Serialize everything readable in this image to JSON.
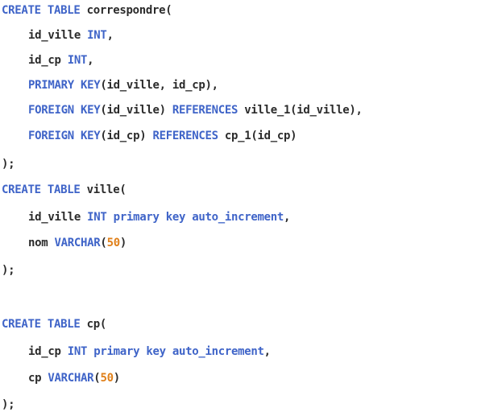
{
  "colors": {
    "keyword": "#3f64c8",
    "number": "#e0801a",
    "text": "#2b2b2b",
    "background": "#ffffff"
  },
  "code_lines": [
    {
      "indent": 0,
      "tokens": [
        {
          "t": "CREATE TABLE",
          "k": "kw"
        },
        {
          "t": " correspondre(",
          "k": "id"
        }
      ]
    },
    {
      "indent": 1,
      "tokens": [
        {
          "t": "id_ville ",
          "k": "id"
        },
        {
          "t": "INT",
          "k": "kw"
        },
        {
          "t": ",",
          "k": "id"
        }
      ]
    },
    {
      "indent": 1,
      "tokens": [
        {
          "t": "id_cp ",
          "k": "id"
        },
        {
          "t": "INT",
          "k": "kw"
        },
        {
          "t": ",",
          "k": "id"
        }
      ]
    },
    {
      "indent": 1,
      "tokens": [
        {
          "t": "PRIMARY KEY",
          "k": "kw"
        },
        {
          "t": "(id_ville, id_cp),",
          "k": "id"
        }
      ]
    },
    {
      "indent": 1,
      "tokens": [
        {
          "t": "FOREIGN KEY",
          "k": "kw"
        },
        {
          "t": "(id_ville) ",
          "k": "id"
        },
        {
          "t": "REFERENCES",
          "k": "kw"
        },
        {
          "t": " ville_1(id_ville),",
          "k": "id"
        }
      ]
    },
    {
      "indent": 1,
      "tokens": [
        {
          "t": "FOREIGN KEY",
          "k": "kw"
        },
        {
          "t": "(id_cp) ",
          "k": "id"
        },
        {
          "t": "REFERENCES",
          "k": "kw"
        },
        {
          "t": " cp_1(id_cp)",
          "k": "id"
        }
      ]
    },
    {
      "indent": 0,
      "tokens": [
        {
          "t": ");",
          "k": "id"
        }
      ]
    },
    {
      "indent": 0,
      "tokens": [
        {
          "t": "CREATE TABLE",
          "k": "kw"
        },
        {
          "t": " ville(",
          "k": "id"
        }
      ]
    },
    {
      "indent": 1,
      "tokens": [
        {
          "t": "id_ville ",
          "k": "id"
        },
        {
          "t": "INT primary key auto_increment",
          "k": "kw"
        },
        {
          "t": ",",
          "k": "id"
        }
      ]
    },
    {
      "indent": 1,
      "tokens": [
        {
          "t": "nom ",
          "k": "id"
        },
        {
          "t": "VARCHAR",
          "k": "kw"
        },
        {
          "t": "(",
          "k": "id"
        },
        {
          "t": "50",
          "k": "num"
        },
        {
          "t": ")",
          "k": "id"
        }
      ]
    },
    {
      "indent": 0,
      "tokens": [
        {
          "t": ");",
          "k": "id"
        }
      ]
    },
    {
      "indent": 0,
      "tokens": []
    },
    {
      "indent": 0,
      "tokens": [
        {
          "t": "CREATE TABLE",
          "k": "kw"
        },
        {
          "t": " cp(",
          "k": "id"
        }
      ]
    },
    {
      "indent": 1,
      "tokens": [
        {
          "t": "id_cp ",
          "k": "id"
        },
        {
          "t": "INT primary key auto_increment",
          "k": "kw"
        },
        {
          "t": ",",
          "k": "id"
        }
      ]
    },
    {
      "indent": 1,
      "tokens": [
        {
          "t": "cp ",
          "k": "id"
        },
        {
          "t": "VARCHAR",
          "k": "kw"
        },
        {
          "t": "(",
          "k": "id"
        },
        {
          "t": "50",
          "k": "num"
        },
        {
          "t": ")",
          "k": "id"
        }
      ]
    },
    {
      "indent": 0,
      "tokens": [
        {
          "t": ");",
          "k": "id"
        }
      ]
    }
  ]
}
